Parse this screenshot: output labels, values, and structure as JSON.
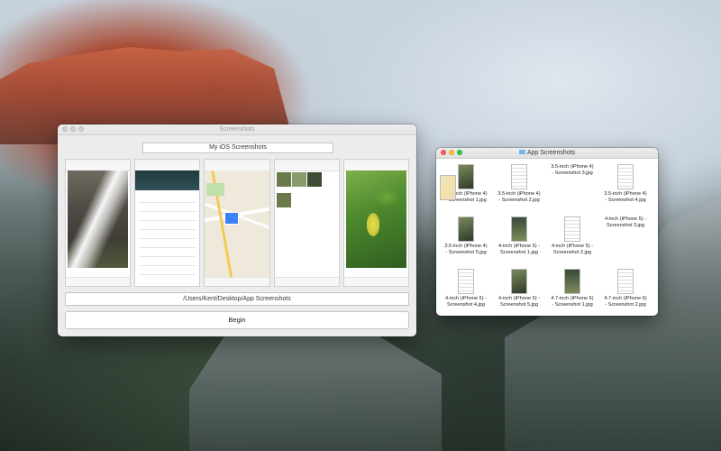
{
  "main_window": {
    "title": "Screenshots",
    "project_name": "My iOS Screenshots",
    "output_path": "/Users/Kent/Desktop/App Screenshots",
    "begin_label": "Begin"
  },
  "finder_window": {
    "title": "App Screenshots",
    "files": [
      {
        "line1": "3.5-inch (iPhone 4)",
        "line2": "- Screenshot 1.jpg",
        "kind": "photo"
      },
      {
        "line1": "3.5-inch (iPhone 4)",
        "line2": "- Screenshot 2.jpg",
        "kind": "doc"
      },
      {
        "line1": "3.5-inch (iPhone 4)",
        "line2": "- Screenshot 3.jpg",
        "kind": "map"
      },
      {
        "line1": "3.5-inch (iPhone 4)",
        "line2": "- Screenshot 4.jpg",
        "kind": "doc"
      },
      {
        "line1": "3.5-inch (iPhone 4)",
        "line2": "- Screenshot 5.jpg",
        "kind": "photo"
      },
      {
        "line1": "4-inch (iPhone 5) -",
        "line2": "Screenshot 1.jpg",
        "kind": "dark"
      },
      {
        "line1": "4-inch (iPhone 5) -",
        "line2": "Screenshot 2.jpg",
        "kind": "doc"
      },
      {
        "line1": "4-inch (iPhone 5) -",
        "line2": "Screenshot 3.jpg",
        "kind": "map"
      },
      {
        "line1": "4-inch (iPhone 5) -",
        "line2": "Screenshot 4.jpg",
        "kind": "doc"
      },
      {
        "line1": "4-inch (iPhone 5) -",
        "line2": "Screenshot 5.jpg",
        "kind": "photo"
      },
      {
        "line1": "4.7-inch (iPhone 6)",
        "line2": "- Screenshot 1.jpg",
        "kind": "dark"
      },
      {
        "line1": "4.7-inch (iPhone 6)",
        "line2": "- Screenshot 2.jpg",
        "kind": "doc"
      }
    ]
  }
}
